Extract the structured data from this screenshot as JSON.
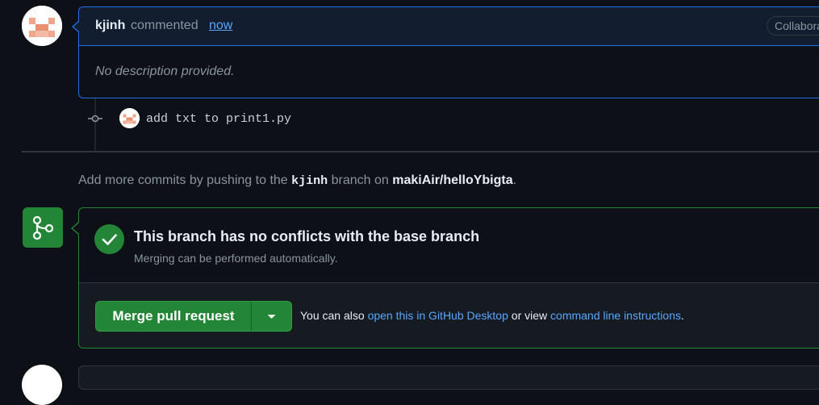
{
  "comment": {
    "author": "kjinh",
    "verb": "commented",
    "time": "now",
    "badge": "Collaborator",
    "body": "No description provided."
  },
  "commit": {
    "message": "add txt to print1.py"
  },
  "hint": {
    "prefix": "Add more commits by pushing to the",
    "branch": "kjinh",
    "middle": "branch on",
    "repo": "makiAir/helloYbigta",
    "suffix": "."
  },
  "merge": {
    "status_title": "This branch has no conflicts with the base branch",
    "status_subtitle": "Merging can be performed automatically.",
    "button_label": "Merge pull request",
    "also_prefix": "You can also",
    "desktop_link": "open this in GitHub Desktop",
    "or_view": "or view",
    "cli_link": "command line instructions",
    "also_suffix": "."
  },
  "colors": {
    "background": "#0d1117",
    "accent_blue": "#1f6feb",
    "link": "#58a6ff",
    "success_green": "#238636",
    "muted_text": "#8b949e"
  },
  "icons": {
    "avatar": "identicon-avatar",
    "commit": "git-commit-icon",
    "merge": "git-merge-icon",
    "check": "check-icon",
    "dropdown": "triangle-down-icon"
  }
}
